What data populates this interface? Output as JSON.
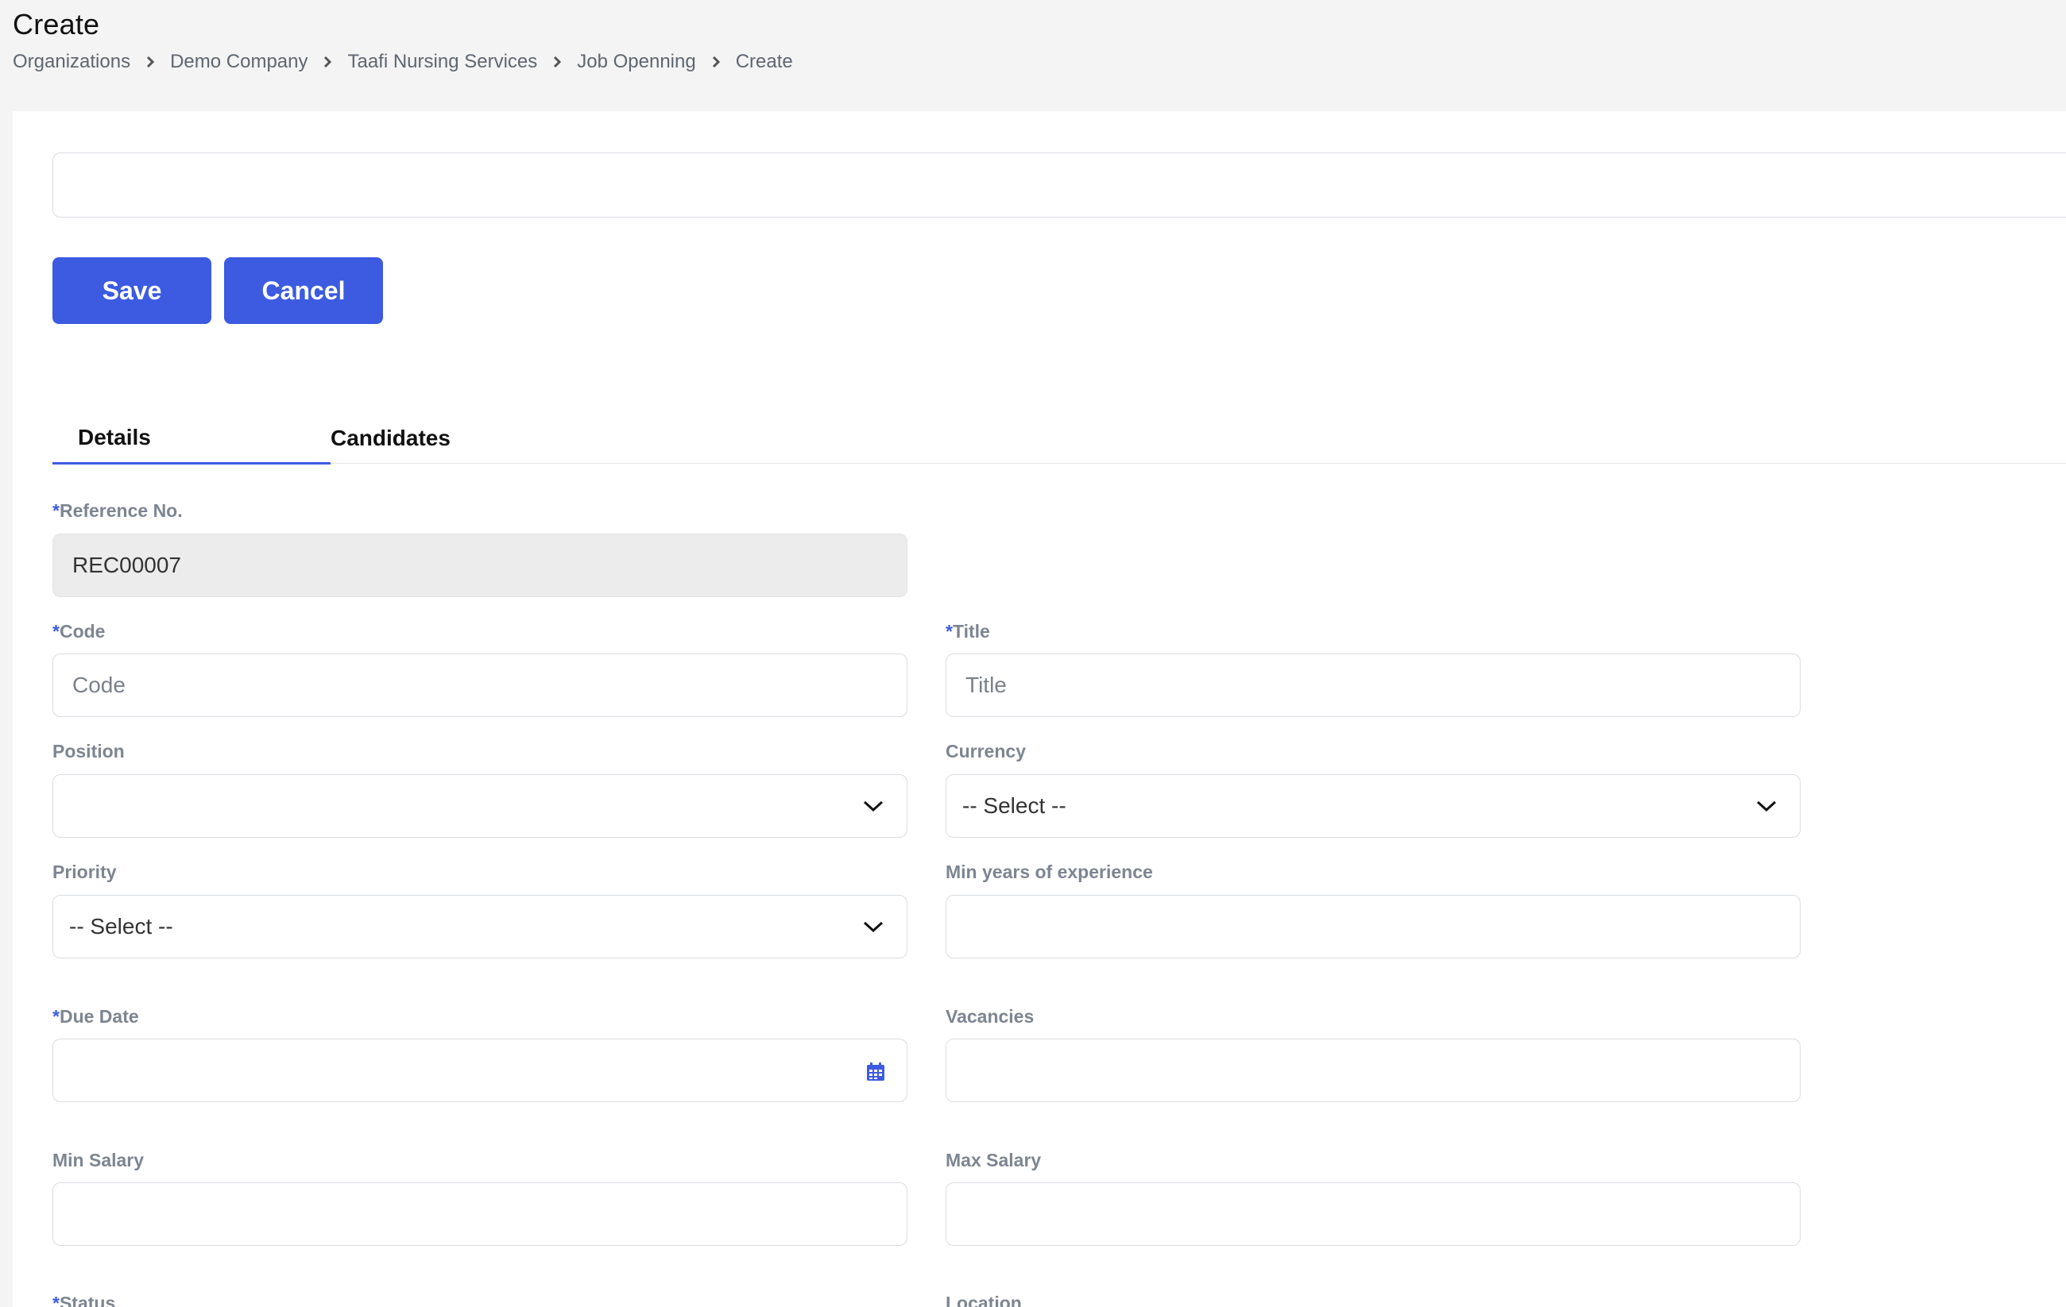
{
  "page": {
    "title": "Create",
    "breadcrumb": [
      "Organizations",
      "Demo Company",
      "Taafi Nursing Services",
      "Job Openning",
      "Create"
    ]
  },
  "actions": {
    "save_label": "Save",
    "cancel_label": "Cancel"
  },
  "tabs": [
    {
      "label": "Details",
      "active": true
    },
    {
      "label": "Candidates",
      "active": false
    }
  ],
  "form": {
    "reference_no": {
      "label": "Reference No.",
      "required": "*",
      "value": "REC00007"
    },
    "code": {
      "label": "Code",
      "required": "*",
      "placeholder": "Code"
    },
    "title": {
      "label": "Title",
      "required": "*",
      "placeholder": "Title"
    },
    "position": {
      "label": "Position",
      "value": ""
    },
    "currency": {
      "label": "Currency",
      "value": "-- Select --"
    },
    "priority": {
      "label": "Priority",
      "value": "-- Select --"
    },
    "min_years": {
      "label": "Min years of experience",
      "value": ""
    },
    "due_date": {
      "label": "Due Date",
      "required": "*",
      "value": ""
    },
    "vacancies": {
      "label": "Vacancies",
      "value": ""
    },
    "min_salary": {
      "label": "Min Salary",
      "value": ""
    },
    "max_salary": {
      "label": "Max Salary",
      "value": ""
    },
    "status": {
      "label": "Status",
      "required": "*"
    },
    "location": {
      "label": "Location"
    }
  },
  "icons": {
    "breadcrumb_separator": "chevron-right-icon",
    "select_arrow": "chevron-down-icon",
    "date_picker": "calendar-icon"
  },
  "colors": {
    "accent": "#3c5be0",
    "label": "#7d8591",
    "border": "#d9dde2",
    "readonly_bg": "#ececec"
  }
}
